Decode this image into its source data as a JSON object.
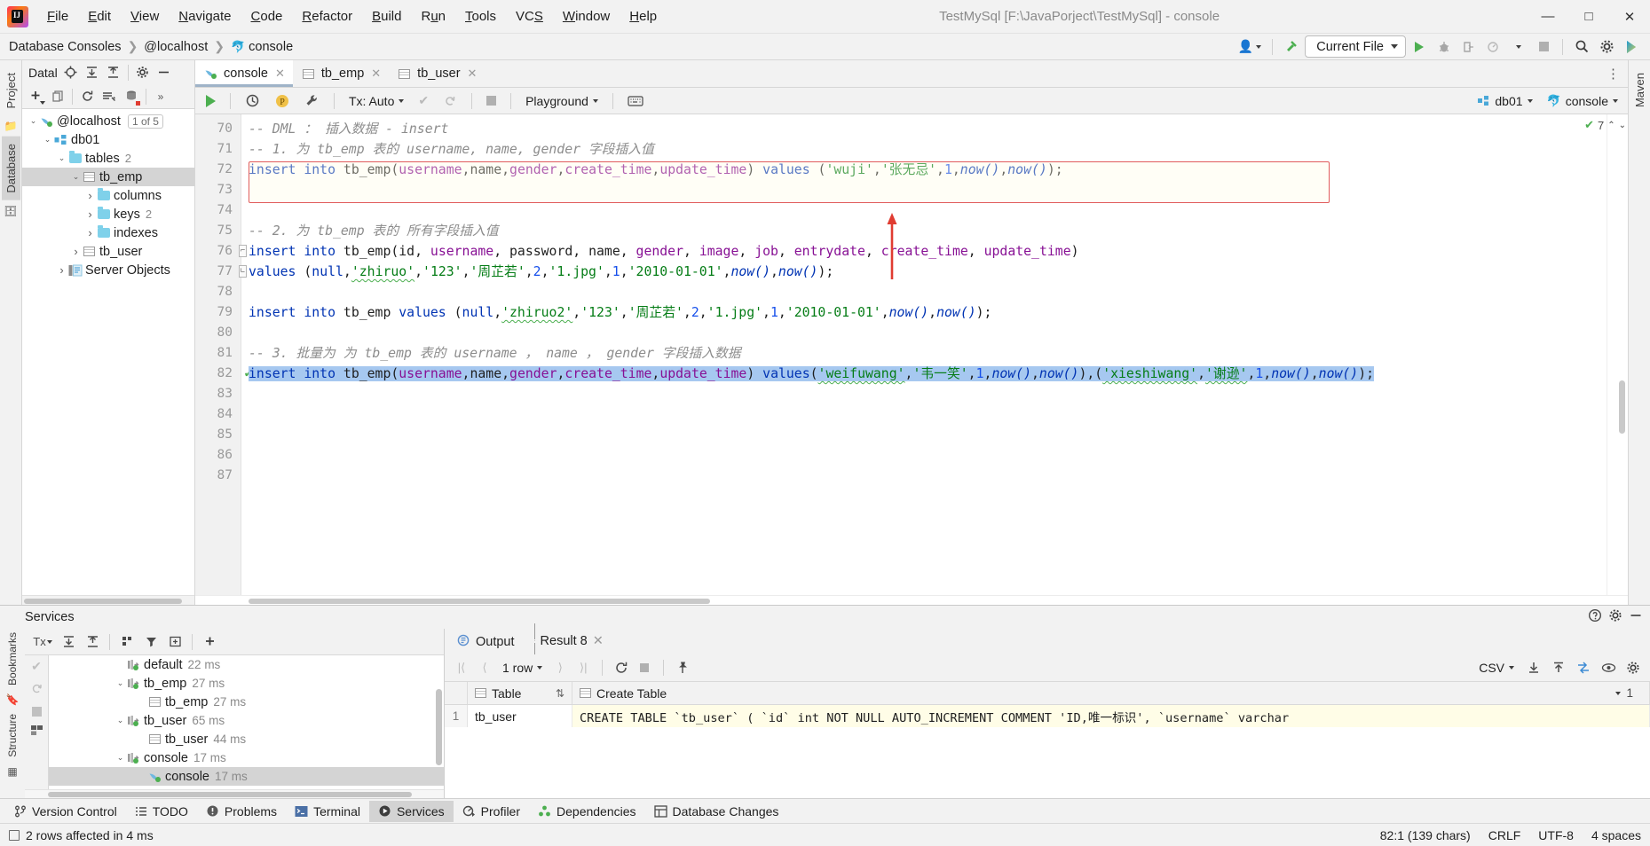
{
  "window": {
    "title": "TestMySql [F:\\JavaPorject\\TestMySql] - console",
    "minimize": "—",
    "maximize": "□",
    "close": "✕"
  },
  "menu": [
    {
      "label": "File"
    },
    {
      "label": "Edit"
    },
    {
      "label": "View"
    },
    {
      "label": "Navigate"
    },
    {
      "label": "Code"
    },
    {
      "label": "Refactor"
    },
    {
      "label": "Build"
    },
    {
      "label": "Run"
    },
    {
      "label": "Tools"
    },
    {
      "label": "VCS"
    },
    {
      "label": "Window"
    },
    {
      "label": "Help"
    }
  ],
  "breadcrumb": {
    "items": [
      "Database Consoles",
      "@localhost",
      "console"
    ],
    "separator": "❯",
    "console_icon": "dolphin-icon"
  },
  "nav_toolbar": {
    "users_icon": "users-icon",
    "build_icon": "hammer-icon",
    "run_config": "Current File",
    "run_icon": "run-icon",
    "debug_icon": "debug-icon",
    "coverage_icon": "coverage-icon",
    "profile_icon": "profile-icon",
    "stop_icon": "stop-icon",
    "search_icon": "search-icon",
    "settings_icon": "gear-icon",
    "updates_icon": "ide-updates-icon"
  },
  "left_stripe": {
    "project_tab": "Project",
    "database_tab": "Database"
  },
  "right_stripe": {
    "maven_tab": "Maven"
  },
  "database_pane": {
    "title": "Datal",
    "header_icons": [
      "target-icon",
      "expand-all-icon",
      "collapse-all-icon",
      "gear-icon",
      "hide-icon"
    ],
    "toolbar_icons": [
      "add-icon",
      "copy-icon",
      "refresh-icon",
      "query-console-icon",
      "data-source-icon",
      "more-icon"
    ],
    "tree": [
      {
        "depth": 0,
        "twisty": "v",
        "icon": "dolphin-icon",
        "label": "@localhost",
        "badge": "1 of 5",
        "count": "",
        "selected": false
      },
      {
        "depth": 1,
        "twisty": "v",
        "icon": "schema-icon",
        "label": "db01",
        "badge": "",
        "count": "",
        "selected": false
      },
      {
        "depth": 2,
        "twisty": "v",
        "icon": "folder-icon",
        "label": "tables",
        "badge": "",
        "count": "2",
        "selected": false
      },
      {
        "depth": 3,
        "twisty": "v",
        "icon": "table-icon",
        "label": "tb_emp",
        "badge": "",
        "count": "",
        "selected": true
      },
      {
        "depth": 4,
        "twisty": ">",
        "icon": "folder-icon",
        "label": "columns",
        "badge": "",
        "count": "",
        "selected": false
      },
      {
        "depth": 4,
        "twisty": ">",
        "icon": "folder-icon",
        "label": "keys",
        "badge": "",
        "count": "2",
        "selected": false
      },
      {
        "depth": 4,
        "twisty": ">",
        "icon": "folder-icon",
        "label": "indexes",
        "badge": "",
        "count": "",
        "selected": false
      },
      {
        "depth": 3,
        "twisty": ">",
        "icon": "table-icon",
        "label": "tb_user",
        "badge": "",
        "count": "",
        "selected": false
      },
      {
        "depth": 2,
        "twisty": ">",
        "icon": "server-objects-icon",
        "label": "Server Objects",
        "badge": "",
        "count": "",
        "selected": false
      }
    ]
  },
  "editor": {
    "tabs": [
      {
        "label": "console",
        "icon": "dolphin-icon",
        "active": true,
        "close": "✕"
      },
      {
        "label": "tb_emp",
        "icon": "table-icon",
        "active": false,
        "close": "✕"
      },
      {
        "label": "tb_user",
        "icon": "table-icon",
        "active": false,
        "close": "✕"
      }
    ],
    "tab_options_icon": "more-options-icon",
    "toolbar": {
      "execute_icon": "run-icon",
      "history_icon": "history-icon",
      "param_icon": "parameters-icon",
      "settings_icon": "wrench-icon",
      "tx_label": "Tx: Auto",
      "commit_icon": "commit-icon",
      "rollback_icon": "rollback-icon",
      "stop_icon": "stop-icon",
      "schema_label": "Playground",
      "keyboard_icon": "keyboard-icon",
      "datasource_label": "db01",
      "datasource_icon": "schema-icon",
      "session_label": "console",
      "session_icon": "dolphin-icon"
    },
    "inspection": {
      "count": "7",
      "check_icon": "inspection-ok-icon",
      "up": "⌃",
      "down": "⌄"
    },
    "first_line": 70,
    "lines": [
      {
        "n": 70,
        "marked": false,
        "fold": false,
        "tokens": [
          {
            "t": "-- DML ： 插入数据 - insert",
            "c": "cmt"
          }
        ]
      },
      {
        "n": 71,
        "marked": false,
        "fold": false,
        "tokens": [
          {
            "t": "-- 1. 为 tb_emp 表的 username, name, gender 字段插入值",
            "c": "cmt"
          }
        ]
      },
      {
        "n": 72,
        "marked": false,
        "fold": false,
        "tokens": [
          {
            "t": "insert into ",
            "c": "kw"
          },
          {
            "t": "tb_emp(",
            "c": "pl"
          },
          {
            "t": "username",
            "c": "col"
          },
          {
            "t": ",",
            "c": "pl"
          },
          {
            "t": "name",
            "c": "pl"
          },
          {
            "t": ",",
            "c": "pl"
          },
          {
            "t": "gender",
            "c": "col"
          },
          {
            "t": ",",
            "c": "pl"
          },
          {
            "t": "create_time",
            "c": "col"
          },
          {
            "t": ",",
            "c": "pl"
          },
          {
            "t": "update_time",
            "c": "col"
          },
          {
            "t": ") ",
            "c": "pl"
          },
          {
            "t": "values",
            "c": "kw"
          },
          {
            "t": " (",
            "c": "pl"
          },
          {
            "t": "'wuji'",
            "c": "str"
          },
          {
            "t": ",",
            "c": "pl"
          },
          {
            "t": "'张无忌'",
            "c": "str"
          },
          {
            "t": ",",
            "c": "pl"
          },
          {
            "t": "1",
            "c": "num"
          },
          {
            "t": ",",
            "c": "pl"
          },
          {
            "t": "now()",
            "c": "fn"
          },
          {
            "t": ",",
            "c": "pl"
          },
          {
            "t": "now()",
            "c": "fn"
          },
          {
            "t": ");",
            "c": "pl"
          }
        ]
      },
      {
        "n": 73,
        "marked": false,
        "fold": false,
        "tokens": []
      },
      {
        "n": 74,
        "marked": false,
        "fold": false,
        "tokens": []
      },
      {
        "n": 75,
        "marked": false,
        "fold": false,
        "tokens": [
          {
            "t": "-- 2. 为 tb_emp 表的 所有字段插入值",
            "c": "cmt"
          }
        ]
      },
      {
        "n": 76,
        "marked": false,
        "fold": "top",
        "tokens": [
          {
            "t": "insert into ",
            "c": "kw"
          },
          {
            "t": "tb_emp(id, ",
            "c": "pl"
          },
          {
            "t": "username",
            "c": "col"
          },
          {
            "t": ", password, name, ",
            "c": "pl"
          },
          {
            "t": "gender",
            "c": "col"
          },
          {
            "t": ", ",
            "c": "pl"
          },
          {
            "t": "image",
            "c": "col"
          },
          {
            "t": ", ",
            "c": "pl"
          },
          {
            "t": "job",
            "c": "col"
          },
          {
            "t": ", ",
            "c": "pl"
          },
          {
            "t": "entrydate",
            "c": "col"
          },
          {
            "t": ", ",
            "c": "pl"
          },
          {
            "t": "create_time",
            "c": "col"
          },
          {
            "t": ", ",
            "c": "pl"
          },
          {
            "t": "update_time",
            "c": "col"
          },
          {
            "t": ")",
            "c": "pl"
          }
        ]
      },
      {
        "n": 77,
        "marked": false,
        "fold": "bot",
        "tokens": [
          {
            "t": "values",
            "c": "kw"
          },
          {
            "t": " (",
            "c": "pl"
          },
          {
            "t": "null",
            "c": "kw"
          },
          {
            "t": ",",
            "c": "pl"
          },
          {
            "t": "'zhiruo'",
            "c": "str err"
          },
          {
            "t": ",",
            "c": "pl"
          },
          {
            "t": "'123'",
            "c": "str"
          },
          {
            "t": ",",
            "c": "pl"
          },
          {
            "t": "'周芷若'",
            "c": "str"
          },
          {
            "t": ",",
            "c": "pl"
          },
          {
            "t": "2",
            "c": "num"
          },
          {
            "t": ",",
            "c": "pl"
          },
          {
            "t": "'1.jpg'",
            "c": "str"
          },
          {
            "t": ",",
            "c": "pl"
          },
          {
            "t": "1",
            "c": "num"
          },
          {
            "t": ",",
            "c": "pl"
          },
          {
            "t": "'2010-01-01'",
            "c": "str"
          },
          {
            "t": ",",
            "c": "pl"
          },
          {
            "t": "now()",
            "c": "fn"
          },
          {
            "t": ",",
            "c": "pl"
          },
          {
            "t": "now()",
            "c": "fn"
          },
          {
            "t": ");",
            "c": "pl"
          }
        ]
      },
      {
        "n": 78,
        "marked": false,
        "fold": false,
        "tokens": []
      },
      {
        "n": 79,
        "marked": false,
        "fold": false,
        "tokens": [
          {
            "t": "insert into ",
            "c": "kw"
          },
          {
            "t": "tb_emp ",
            "c": "pl"
          },
          {
            "t": "values",
            "c": "kw"
          },
          {
            "t": " (",
            "c": "pl"
          },
          {
            "t": "null",
            "c": "kw"
          },
          {
            "t": ",",
            "c": "pl"
          },
          {
            "t": "'zhiruo2'",
            "c": "str err"
          },
          {
            "t": ",",
            "c": "pl"
          },
          {
            "t": "'123'",
            "c": "str"
          },
          {
            "t": ",",
            "c": "pl"
          },
          {
            "t": "'周芷若'",
            "c": "str"
          },
          {
            "t": ",",
            "c": "pl"
          },
          {
            "t": "2",
            "c": "num"
          },
          {
            "t": ",",
            "c": "pl"
          },
          {
            "t": "'1.jpg'",
            "c": "str"
          },
          {
            "t": ",",
            "c": "pl"
          },
          {
            "t": "1",
            "c": "num"
          },
          {
            "t": ",",
            "c": "pl"
          },
          {
            "t": "'2010-01-01'",
            "c": "str"
          },
          {
            "t": ",",
            "c": "pl"
          },
          {
            "t": "now()",
            "c": "fn"
          },
          {
            "t": ",",
            "c": "pl"
          },
          {
            "t": "now()",
            "c": "fn"
          },
          {
            "t": ");",
            "c": "pl"
          }
        ]
      },
      {
        "n": 80,
        "marked": false,
        "fold": false,
        "tokens": []
      },
      {
        "n": 81,
        "marked": false,
        "fold": false,
        "tokens": [
          {
            "t": "-- 3. 批量为 为 tb_emp 表的 username ， name ， gender 字段插入数据",
            "c": "cmt"
          }
        ]
      },
      {
        "n": 82,
        "marked": true,
        "fold": false,
        "selected": true,
        "tokens": [
          {
            "t": "insert into ",
            "c": "kw"
          },
          {
            "t": "tb_emp(",
            "c": "pl"
          },
          {
            "t": "username",
            "c": "col"
          },
          {
            "t": ",",
            "c": "pl"
          },
          {
            "t": "name",
            "c": "pl"
          },
          {
            "t": ",",
            "c": "pl"
          },
          {
            "t": "gender",
            "c": "col"
          },
          {
            "t": ",",
            "c": "pl"
          },
          {
            "t": "create_time",
            "c": "col"
          },
          {
            "t": ",",
            "c": "pl"
          },
          {
            "t": "update_time",
            "c": "col"
          },
          {
            "t": ") ",
            "c": "pl"
          },
          {
            "t": "values",
            "c": "kw"
          },
          {
            "t": "(",
            "c": "pl"
          },
          {
            "t": "'weifuwang'",
            "c": "str err"
          },
          {
            "t": ",",
            "c": "pl"
          },
          {
            "t": "'韦一笑'",
            "c": "str"
          },
          {
            "t": ",",
            "c": "pl"
          },
          {
            "t": "1",
            "c": "num"
          },
          {
            "t": ",",
            "c": "pl"
          },
          {
            "t": "now()",
            "c": "fn"
          },
          {
            "t": ",",
            "c": "pl"
          },
          {
            "t": "now()",
            "c": "fn"
          },
          {
            "t": "),(",
            "c": "pl"
          },
          {
            "t": "'xieshiwang'",
            "c": "str err"
          },
          {
            "t": ",",
            "c": "pl"
          },
          {
            "t": "'谢逊'",
            "c": "str err"
          },
          {
            "t": ",",
            "c": "pl"
          },
          {
            "t": "1",
            "c": "num"
          },
          {
            "t": ",",
            "c": "pl"
          },
          {
            "t": "now()",
            "c": "fn"
          },
          {
            "t": ",",
            "c": "pl"
          },
          {
            "t": "now()",
            "c": "fn"
          },
          {
            "t": ");",
            "c": "pl"
          }
        ]
      },
      {
        "n": 83,
        "marked": false,
        "fold": false,
        "tokens": []
      },
      {
        "n": 84,
        "marked": false,
        "fold": false,
        "tokens": []
      },
      {
        "n": 85,
        "marked": false,
        "fold": false,
        "tokens": []
      },
      {
        "n": 86,
        "marked": false,
        "fold": false,
        "tokens": []
      },
      {
        "n": 87,
        "marked": false,
        "fold": false,
        "tokens": []
      }
    ]
  },
  "services": {
    "title": "Services",
    "header_icons": [
      "help-icon",
      "gear-icon",
      "hide-icon"
    ],
    "side_toolbar": [
      "tx-icon",
      "commit-icon",
      "rollback-icon",
      "stop-icon",
      "layout-icon"
    ],
    "toolbar_icons": [
      "expand-all-icon",
      "collapse-all-icon",
      "group-icon",
      "filter-icon",
      "add-tab-icon",
      "add-icon"
    ],
    "tree": [
      {
        "depth": 1,
        "twisty": "",
        "icon": "connection-icon",
        "label": "default",
        "time": "22 ms",
        "selected": false
      },
      {
        "depth": 1,
        "twisty": "v",
        "icon": "connection-icon",
        "label": "tb_emp",
        "time": "27 ms",
        "selected": false
      },
      {
        "depth": 2,
        "twisty": "",
        "icon": "table-icon",
        "label": "tb_emp",
        "time": "27 ms",
        "selected": false
      },
      {
        "depth": 1,
        "twisty": "v",
        "icon": "connection-icon",
        "label": "tb_user",
        "time": "65 ms",
        "selected": false
      },
      {
        "depth": 2,
        "twisty": "",
        "icon": "table-icon",
        "label": "tb_user",
        "time": "44 ms",
        "selected": false
      },
      {
        "depth": 1,
        "twisty": "v",
        "icon": "connection-icon",
        "label": "console",
        "time": "17 ms",
        "selected": false
      },
      {
        "depth": 2,
        "twisty": "",
        "icon": "dolphin-icon",
        "label": "console",
        "time": "17 ms",
        "selected": true
      }
    ]
  },
  "result": {
    "tabs": [
      {
        "label": "Output",
        "icon": "output-icon",
        "active": false,
        "close": ""
      },
      {
        "label": "Result 8",
        "icon": "table-icon",
        "active": true,
        "close": "✕"
      }
    ],
    "toolbar": {
      "first_icon": "first-page-icon",
      "prev_icon": "prev-page-icon",
      "row_count": "1 row",
      "next_icon": "next-page-icon",
      "last_icon": "last-page-icon",
      "reload_icon": "reload-icon",
      "stop_icon": "stop-icon",
      "pin_icon": "pin-icon",
      "format_label": "CSV",
      "export_icon": "export-icon",
      "import_icon": "import-icon",
      "compare_icon": "compare-icon",
      "view_icon": "view-options-icon",
      "settings_icon": "gear-icon"
    },
    "grid": {
      "columns": [
        {
          "label": "Table",
          "icon": "table-icon",
          "sort": "⇅"
        },
        {
          "label": "Create Table",
          "icon": "table-icon",
          "sort": ""
        }
      ],
      "row_badge": "1",
      "rows": [
        {
          "num": "1",
          "cells": [
            "tb_user",
            "CREATE TABLE `tb_user` (  `id` int NOT NULL AUTO_INCREMENT COMMENT 'ID,唯一标识',  `username` varchar"
          ]
        }
      ]
    }
  },
  "bottom_bar": [
    {
      "label": "Version Control",
      "icon": "branch-icon",
      "selected": false
    },
    {
      "label": "TODO",
      "icon": "todo-icon",
      "selected": false
    },
    {
      "label": "Problems",
      "icon": "problems-icon",
      "selected": false
    },
    {
      "label": "Terminal",
      "icon": "terminal-icon",
      "selected": false
    },
    {
      "label": "Services",
      "icon": "services-icon",
      "selected": true
    },
    {
      "label": "Profiler",
      "icon": "profiler-icon",
      "selected": false
    },
    {
      "label": "Dependencies",
      "icon": "dependencies-icon",
      "selected": false
    },
    {
      "label": "Database Changes",
      "icon": "db-changes-icon",
      "selected": false
    }
  ],
  "status_bar": {
    "message": "2 rows affected in 4 ms",
    "caret": "82:1 (139 chars)",
    "line_sep": "CRLF",
    "encoding": "UTF-8",
    "indent": "4 spaces"
  },
  "left_side_tabs": [
    "Bookmarks",
    "Structure"
  ],
  "colors": {
    "accent_blue": "#0033b3",
    "string_green": "#067d17",
    "column_purple": "#871094",
    "number_blue": "#1750eb",
    "comment_gray": "#8c8c8c",
    "selection_blue": "#a6c8f0",
    "annotation_red": "#e03c31",
    "run_green": "#4caf50"
  }
}
